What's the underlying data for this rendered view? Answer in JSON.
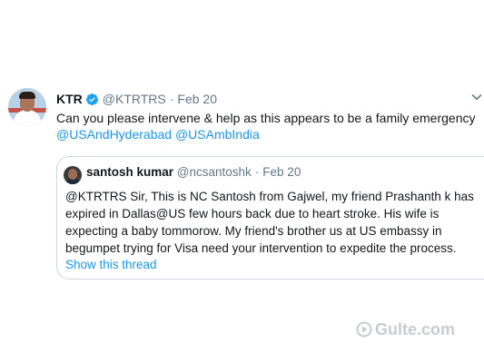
{
  "tweet": {
    "name": "KTR",
    "handle": "@KTRTRS",
    "separator": "·",
    "date": "Feb 20",
    "text_line1": "Can you please intervene & help as this appears to be a family emergency",
    "mention1": "@USAndHyderabad",
    "mention2": "@USAmbIndia"
  },
  "quote": {
    "name": "santosh kumar",
    "handle": "@ncsantoshk",
    "separator": "·",
    "date": "Feb 20",
    "lines": [
      "@KTRTRS Sir, This is NC Santosh from Gajwel, my friend Prashanth k has",
      "expired in Dallas@US few hours back due to heart stroke. His wife is",
      "expecting a baby tommorow. My friend's brother us at US embassy in",
      "begumpet trying for Visa need your intervention to expedite the process."
    ],
    "show_thread": "Show this thread"
  },
  "watermark": {
    "text": "Gulte.com"
  },
  "colors": {
    "link": "#1b95e0",
    "muted": "#657786",
    "border": "#ccd6dd"
  }
}
